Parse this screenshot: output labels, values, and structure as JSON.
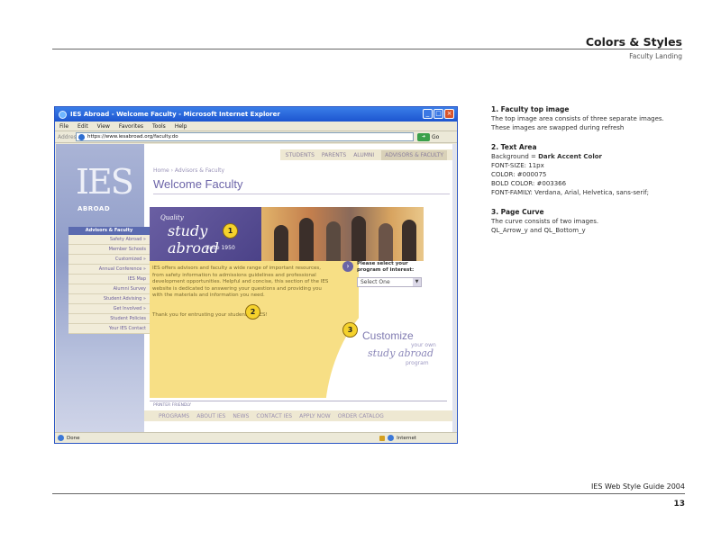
{
  "header": {
    "title": "Colors & Styles",
    "subtitle": "Faculty Landing"
  },
  "browser": {
    "title": "IES Abroad - Welcome Faculty - Microsoft Internet Explorer",
    "menu": [
      "File",
      "Edit",
      "View",
      "Favorites",
      "Tools",
      "Help"
    ],
    "address_label": "Address",
    "url": "https://www.iesabroad.org/faculty.do",
    "go_label": "Go",
    "status": "Done",
    "zone": "Internet"
  },
  "site": {
    "logo": "IES",
    "logo_sub": "ABROAD",
    "top_nav": [
      "STUDENTS",
      "PARENTS",
      "ALUMNI",
      "ADVISORS & FACULTY"
    ],
    "breadcrumb": "Home › Advisors & Faculty",
    "page_title": "Welcome Faculty",
    "sidenav_head": "Advisors & Faculty",
    "sidenav": [
      "Safety Abroad »",
      "Member Schools",
      "Customized »",
      "Annual Conference »",
      "IES Map",
      "Alumni Survey",
      "Student Advising »",
      "Get Involved »",
      "Student Policies",
      "Your IES Contact"
    ],
    "photo": {
      "quality": "Quality",
      "script": "study abroad",
      "since": "since 1950"
    },
    "body_text": "IES offers advisors and faculty a wide range of important resources, from safety information to admissions guidelines and professional development opportunities. Helpful and concise, this section of the IES website is dedicated to answering your questions and providing you with the materials and information you need.",
    "thanks": "Thank you for entrusting your students to IES!",
    "select_label": "Please select your program of interest:",
    "select_value": "Select One",
    "customize": "Customize",
    "your_own": "your own",
    "study_abroad": "study abroad",
    "program": "program",
    "printer": "PRINTER FRIENDLY",
    "foot_nav": [
      "PROGRAMS",
      "ABOUT IES",
      "NEWS",
      "CONTACT IES",
      "APPLY NOW",
      "ORDER CATALOG"
    ]
  },
  "markers": [
    "1",
    "2",
    "3"
  ],
  "notes": [
    {
      "heading": "1. Faculty top image",
      "lines": [
        "The top image area consists of three separate images.",
        "These images are swapped during refresh"
      ]
    },
    {
      "heading": "2. Text Area",
      "lines": [
        "Background = ",
        "FONT-SIZE: 11px",
        "COLOR: #000075",
        "BOLD COLOR: #003366",
        "FONT-FAMILY: Verdana, Arial, Helvetica, sans-serif;"
      ],
      "bold_part": "Dark Accent Color"
    },
    {
      "heading": "3. Page Curve",
      "lines": [
        "The curve consists of two images.",
        "QL_Arrow_y and QL_Bottom_y"
      ]
    }
  ],
  "footer": {
    "title": "IES Web Style Guide 2004",
    "page": "13"
  },
  "colors": {
    "accent": "#6c64a8",
    "text_area_bg": "#f7df85",
    "nav_bg": "#eee8d2"
  }
}
